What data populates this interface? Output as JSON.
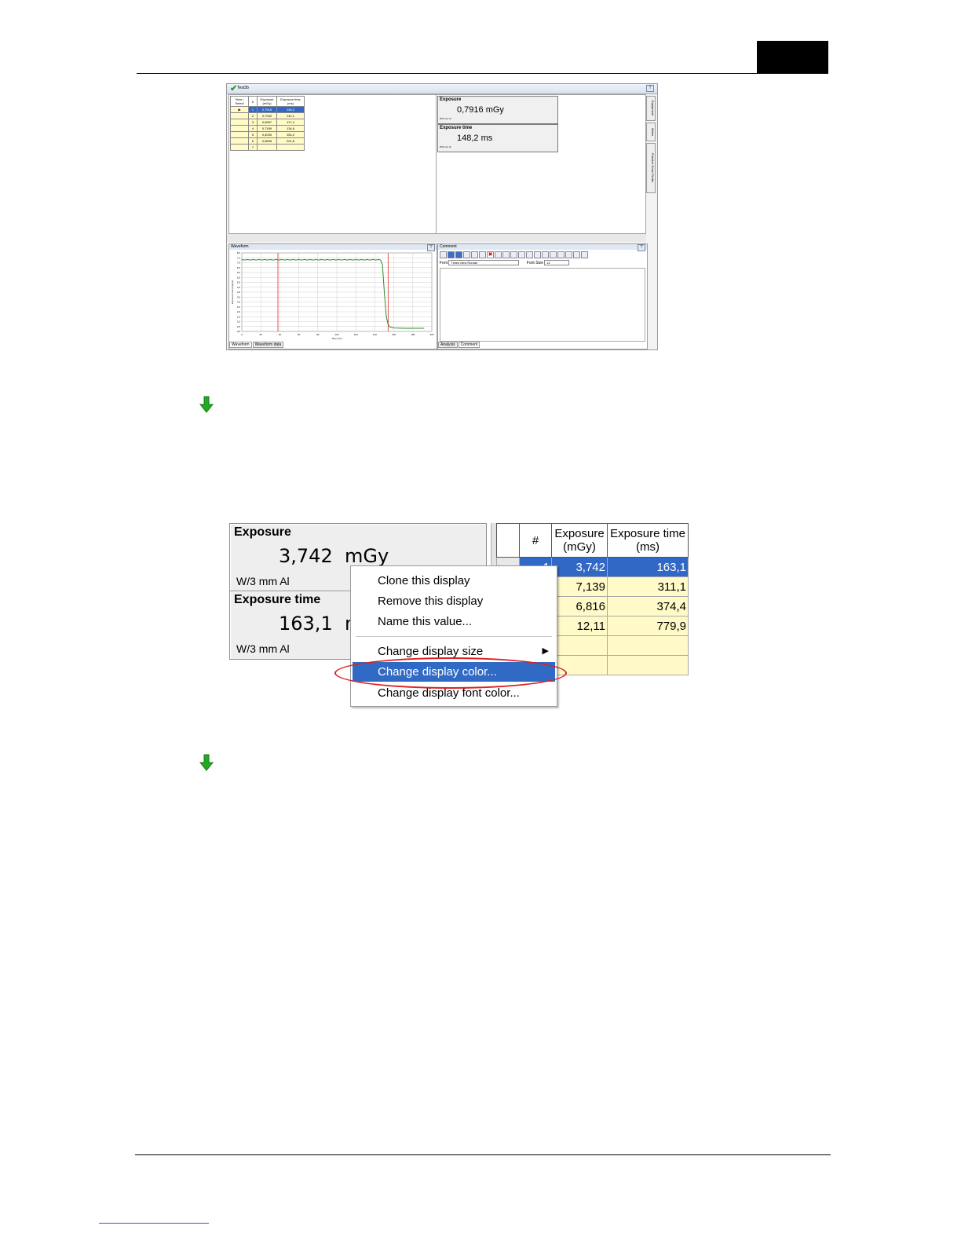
{
  "shot1": {
    "window_title": "Test3b",
    "pin": "⊤",
    "table": {
      "headers": [
        "View / Select",
        "#",
        "Exposure (mGy)",
        "Exposure time (ms)"
      ],
      "rows": [
        {
          "n": "1",
          "exposure": "0,7916",
          "time": "148,2"
        },
        {
          "n": "2",
          "exposure": "0,7942",
          "time": "142,1"
        },
        {
          "n": "3",
          "exposure": "0,8287",
          "time": "117,4"
        },
        {
          "n": "4",
          "exposure": "0,7189",
          "time": "134,6"
        },
        {
          "n": "5",
          "exposure": "0,4030",
          "time": "154,2"
        },
        {
          "n": "6",
          "exposure": "0,5896",
          "time": "201,8"
        },
        {
          "n": "7",
          "exposure": "",
          "time": ""
        }
      ]
    },
    "displays": [
      {
        "label": "Exposure",
        "value": "0,7916 mGy",
        "foot": "W/3 mm Al"
      },
      {
        "label": "Exposure time",
        "value": "148,2 ms",
        "foot": "W/3 mm Al"
      }
    ],
    "side_tabs": [
      "Equipment",
      "Meter",
      "Practice Dose Finder"
    ],
    "waveform": {
      "title": "Waveform",
      "ylabel": "Exposure rate (mGy/s)",
      "xlabel": "Time (ms)",
      "y_ticks": [
        "8,0",
        "7,5",
        "7,0",
        "6,5",
        "6,0",
        "5,5",
        "5,0",
        "4,5",
        "4,0",
        "3,5",
        "3,0",
        "2,5",
        "2,0",
        "1,5",
        "1,0",
        "0,5",
        "0,0"
      ],
      "x_ticks": [
        "0",
        "20",
        "40",
        "60",
        "80",
        "100",
        "120",
        "140",
        "160",
        "180",
        "200"
      ],
      "xlim": [
        0,
        200
      ],
      "ylim": [
        0,
        8.0
      ],
      "markers_x": [
        38,
        154
      ],
      "tabs": [
        "Waveform",
        "Waveform data"
      ],
      "line_color": "#2e8b2e",
      "marker_color": "#e03030"
    },
    "comment": {
      "title": "Comment",
      "font_label": "Font",
      "font_value": "Times New Roman",
      "size_label": "Font Size",
      "size_value": "12",
      "tabs": [
        "Analysis",
        "Comment"
      ]
    }
  },
  "shot2": {
    "displays": [
      {
        "label": "Exposure",
        "value": "3,742  mGy",
        "foot": "W/3 mm Al"
      },
      {
        "label": "Exposure time",
        "value": "163,1  ms",
        "foot": "W/3 mm Al"
      }
    ],
    "grid": {
      "headers": [
        "#",
        "Exposure (mGy)",
        "Exposure time (ms)"
      ],
      "rows": [
        {
          "n": "1",
          "exposure": "3,742",
          "time": "163,1"
        },
        {
          "n": "2",
          "exposure": "7,139",
          "time": "311,1"
        },
        {
          "n": "3",
          "exposure": "6,816",
          "time": "374,4"
        },
        {
          "n": "4",
          "exposure": "12,11",
          "time": "779,9"
        },
        {
          "n": "",
          "exposure": "",
          "time": ""
        },
        {
          "n": "",
          "exposure": "",
          "time": ""
        }
      ]
    },
    "context_menu": [
      "Clone this display",
      "Remove this display",
      "Name this value...",
      "Change display size",
      "Change display color...",
      "Change display font color..."
    ],
    "highlight_color": "#316ac5",
    "ring_color": "#dd1f1f"
  }
}
